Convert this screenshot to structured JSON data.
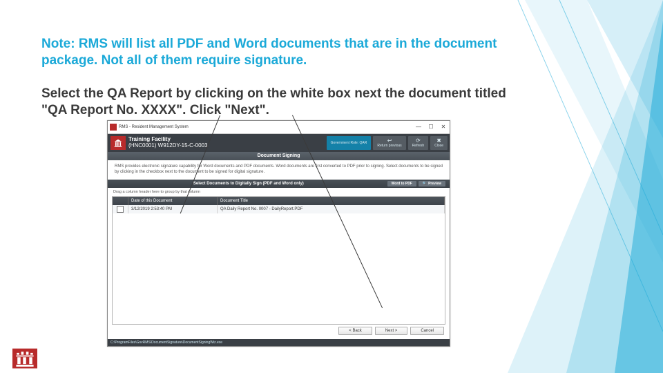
{
  "note": "Note: RMS will list all PDF and Word documents that are in the document package. Not all of them require signature.",
  "instruction": "Select the QA Report by clicking on the white box next the document titled \"QA Report No. XXXX\".  Click \"Next\".",
  "app": {
    "windowTitle": "RMS - Resident Management System",
    "facilityName": "Training Facility",
    "facilitySub": "(HNC0001) W912DY-15-C-0003",
    "btn_govrole": "Government Role: QAR",
    "btn_back": "Return previous",
    "btn_refresh": "Refresh",
    "btn_close": "Close",
    "sectionTitle": "Document Signing",
    "description": "RMS provides electronic signature capability for Word documents and PDF documents. Word documents are first converted to PDF prior to signing. Select documents to be signed by clicking in the checkbox next to the document to be signed for digital signature.",
    "selectBar": "Select Documents to Digitally Sign (PDF and Word only)",
    "word2pdf": "Word to PDF",
    "preview": "Preview",
    "previewIcon": "🔍",
    "hint": "Drag a column header here to group by that column",
    "col_date": "Date of this Document",
    "col_title": "Document Title",
    "row_date": "3/12/2019 2:53:40 PM",
    "row_title": "QA Daily Report No. 0007 - DailyReport.PDF",
    "btn_back2": "< Back",
    "btn_next": "Next >",
    "btn_cancel": "Cancel",
    "status": "C:\\ProgramFiles\\GovRMS\\DocumentSignature\\DocumentSigningWiz.exe"
  }
}
